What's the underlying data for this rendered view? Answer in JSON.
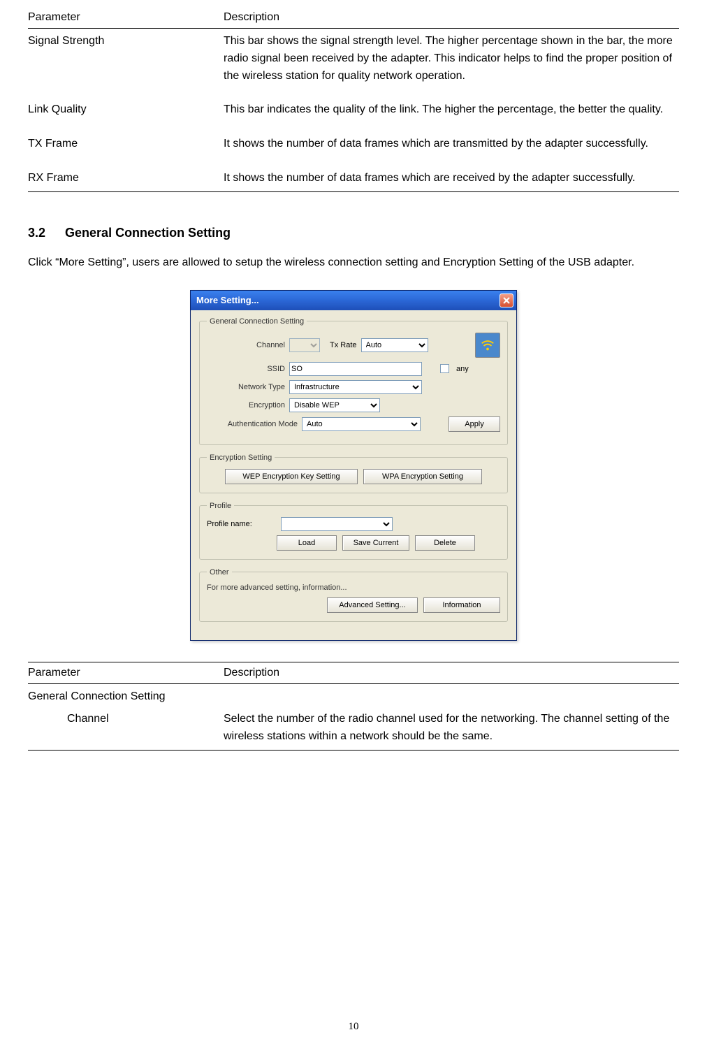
{
  "table1": {
    "header_param": "Parameter",
    "header_desc": "Description",
    "rows": [
      {
        "param": "Signal Strength",
        "desc": "This bar shows the signal strength level. The higher percentage shown in the bar, the more radio signal been received by the adapter. This indicator helps to find the proper position of the wireless station for quality network operation."
      },
      {
        "param": "Link Quality",
        "desc": "This bar indicates the quality of the link. The higher the percentage, the better the quality."
      },
      {
        "param": "TX Frame",
        "desc": "It shows the number of data frames which are transmitted by the adapter successfully."
      },
      {
        "param": "RX Frame",
        "desc": "It shows the number of data frames which are received by the adapter successfully."
      }
    ]
  },
  "section": {
    "number": "3.2",
    "title": "General Connection Setting"
  },
  "intro": "Click “More Setting”, users are allowed to setup the wireless connection setting and Encryption Setting of the USB adapter.",
  "dialog": {
    "title": "More Setting...",
    "group_general": "General Connection Setting",
    "lbl_channel": "Channel",
    "lbl_txrate": "Tx Rate",
    "val_txrate": "Auto",
    "lbl_ssid": "SSID",
    "val_ssid": "SO",
    "lbl_any": "any",
    "lbl_nettype": "Network Type",
    "val_nettype": "Infrastructure",
    "lbl_encryption": "Encryption",
    "val_encryption": "Disable WEP",
    "lbl_authmode": "Authentication Mode",
    "val_authmode": "Auto",
    "btn_apply": "Apply",
    "group_encsetting": "Encryption Setting",
    "btn_wep": "WEP Encryption Key Setting",
    "btn_wpa": "WPA Encryption Setting",
    "group_profile": "Profile",
    "lbl_profilename": "Profile name:",
    "btn_load": "Load",
    "btn_save": "Save Current",
    "btn_delete": "Delete",
    "group_other": "Other",
    "other_text": "For more advanced setting, information...",
    "btn_advanced": "Advanced Setting...",
    "btn_info": "Information"
  },
  "table2": {
    "header_param": "Parameter",
    "header_desc": "Description",
    "group_general": "General Connection Setting",
    "row_channel_param": "Channel",
    "row_channel_desc": "Select the number of the radio channel used for the networking. The channel setting of the wireless stations within a network should be the same."
  },
  "page_number": "10"
}
